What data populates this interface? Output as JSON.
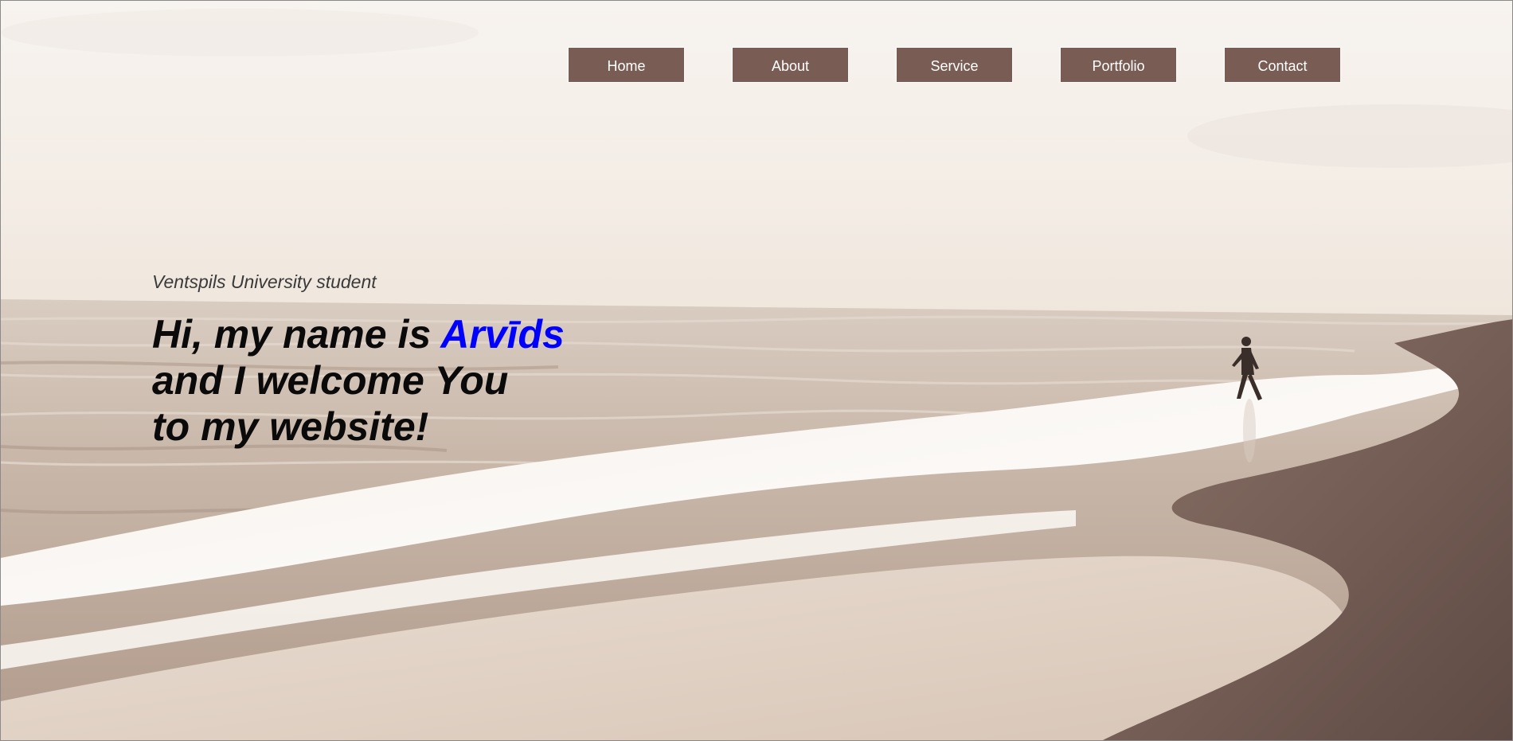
{
  "colors": {
    "nav_button_bg": "#795d55",
    "nav_button_text": "#ffffff",
    "headline_text": "#0a0a0a",
    "name_highlight": "#0000ff",
    "subtitle_text": "#3a3a3a"
  },
  "nav": {
    "items": [
      {
        "label": "Home"
      },
      {
        "label": "About"
      },
      {
        "label": "Service"
      },
      {
        "label": "Portfolio"
      },
      {
        "label": "Contact"
      }
    ]
  },
  "hero": {
    "subtitle": "Ventspils University student",
    "line1_prefix": "Hi, my name is ",
    "name": "Arvīds",
    "line2": "and I welcome You",
    "line3": "to my website!"
  },
  "background": {
    "description_icon": "beach-photo"
  }
}
